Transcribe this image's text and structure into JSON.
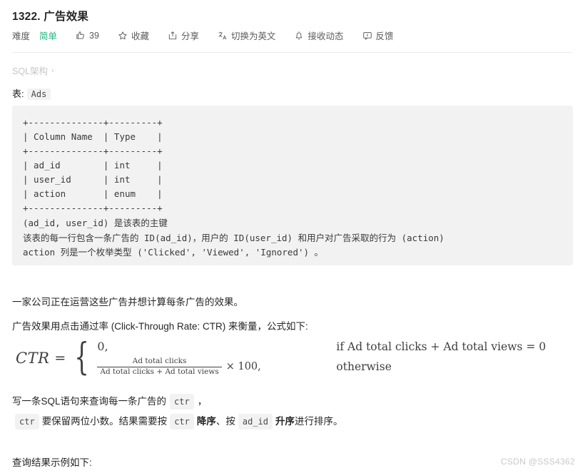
{
  "page": {
    "title": "1322. 广告效果"
  },
  "toolbar": {
    "difficulty_label": "难度",
    "difficulty_value": "简单",
    "like_count": "39",
    "favorite_label": "收藏",
    "share_label": "分享",
    "translate_label": "切换为英文",
    "subscribe_label": "接收动态",
    "feedback_label": "反馈",
    "icons": {
      "like": "thumbs-up-icon",
      "favorite": "star-icon",
      "share": "share-icon",
      "translate": "translate-icon",
      "subscribe": "bell-icon",
      "feedback": "comment-icon"
    }
  },
  "breadcrumb": {
    "label": "SQL架构",
    "arrow": "›"
  },
  "table_intro": {
    "prefix": "表:",
    "name": "Ads"
  },
  "code_block": {
    "schema_ascii": "+--------------+---------+\n| Column Name  | Type    |\n+--------------+---------+\n| ad_id        | int     |\n| user_id      | int     |\n| action       | enum    |\n+--------------+---------+",
    "notes": "(ad_id, user_id) 是该表的主键\n该表的每一行包含一条广告的 ID(ad_id)，用户的 ID(user_id) 和用户对广告采取的行为 (action)\naction 列是一个枚举类型 ('Clicked', 'Viewed', 'Ignored') 。"
  },
  "body": {
    "p_intro": "一家公司正在运营这些广告并想计算每条广告的效果。",
    "p_ctr": "广告效果用点击通过率 (Click-Through Rate: CTR) 来衡量，公式如下:",
    "p_write_prefix": "写一条SQL语句来查询每一条广告的",
    "p_write_code": "ctr",
    "p_write_suffix": "，",
    "p_order_code1": "ctr",
    "p_order_t1": "要保留两位小数。结果需要按",
    "p_order_code2": "ctr",
    "p_order_b1": "降序",
    "p_order_t2": "、按",
    "p_order_code3": "ad_id",
    "p_order_b2": "升序",
    "p_order_t3": "进行排序。",
    "p_result": "查询结果示例如下:"
  },
  "formula": {
    "lhs": "CTR",
    "equals": "=",
    "case1_value": "0,",
    "case1_cond": "if Ad total clicks + Ad total views = 0",
    "case2_num": "Ad total clicks",
    "case2_den": "Ad total clicks + Ad total views",
    "case2_mul": "× 100,",
    "case2_cond": "otherwise"
  },
  "watermark": {
    "text": "CSDN @SSS4362"
  },
  "colors": {
    "difficulty_green": "#21b47a",
    "code_bg": "#f2f2f3",
    "chip_bg": "#f2f2f2",
    "text": "#262626",
    "muted": "#5b5b5b",
    "watermark": "#c9c9c9"
  }
}
